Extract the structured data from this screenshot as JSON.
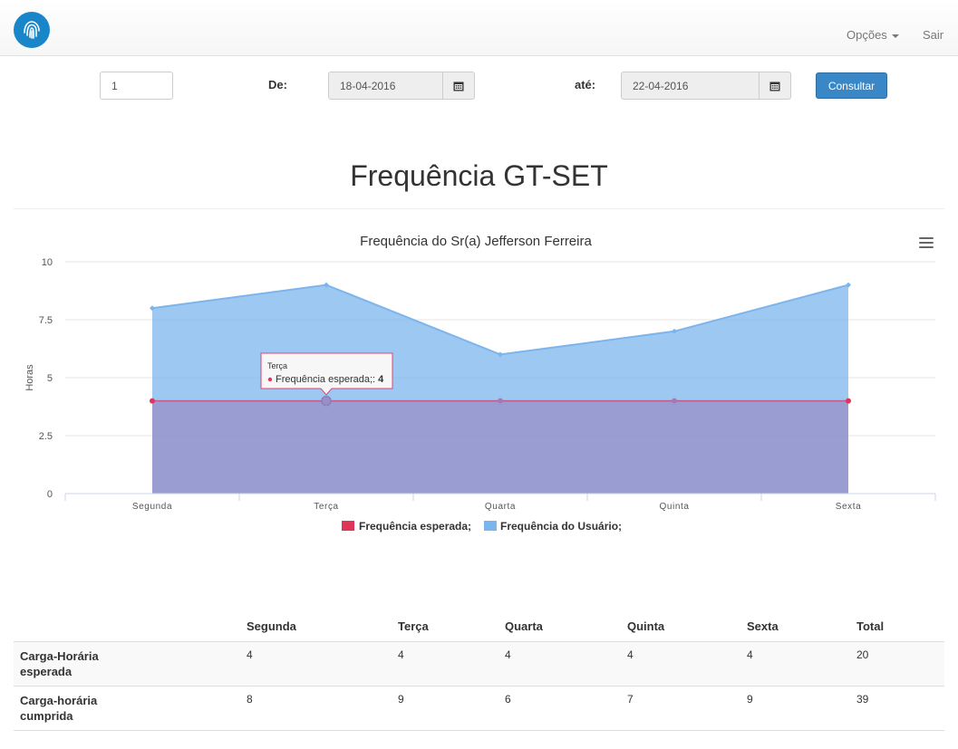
{
  "nav": {
    "opcoes_label": "Opções",
    "sair_label": "Sair"
  },
  "filters": {
    "id_value": "1",
    "de_label": "De:",
    "de_value": "18-04-2016",
    "ate_label": "até:",
    "ate_value": "22-04-2016",
    "consultar_label": "Consultar"
  },
  "page_title": "Frequência GT-SET",
  "chart_data": {
    "type": "area",
    "title": "Frequência do Sr(a) Jefferson Ferreira",
    "ylabel": "Horas",
    "xlabel": "",
    "categories": [
      "Segunda",
      "Terça",
      "Quarta",
      "Quinta",
      "Sexta"
    ],
    "ylim": [
      0,
      10
    ],
    "yticks": [
      "0",
      "2.5",
      "5",
      "7.5",
      "10"
    ],
    "grid": true,
    "legend_position": "bottom-center",
    "series": [
      {
        "name": "Frequência esperada;",
        "values": [
          4,
          4,
          4,
          4,
          4
        ],
        "color": "#e0355a"
      },
      {
        "name": "Frequência do Usuário;",
        "values": [
          8,
          9,
          6,
          7,
          9
        ],
        "color": "#7cb5ec"
      }
    ],
    "tooltip": {
      "category": "Terça",
      "series_label": "Frequência esperada;:",
      "value": "4"
    }
  },
  "table": {
    "headers": [
      "",
      "Segunda",
      "Terça",
      "Quarta",
      "Quinta",
      "Sexta",
      "Total"
    ],
    "rows": [
      {
        "label_line1": "Carga-Horária",
        "label_line2": "esperada",
        "values": [
          "4",
          "4",
          "4",
          "4",
          "4",
          "20"
        ]
      },
      {
        "label_line1": "Carga-horária",
        "label_line2": "cumprida",
        "values": [
          "8",
          "9",
          "6",
          "7",
          "9",
          "39"
        ]
      }
    ]
  }
}
